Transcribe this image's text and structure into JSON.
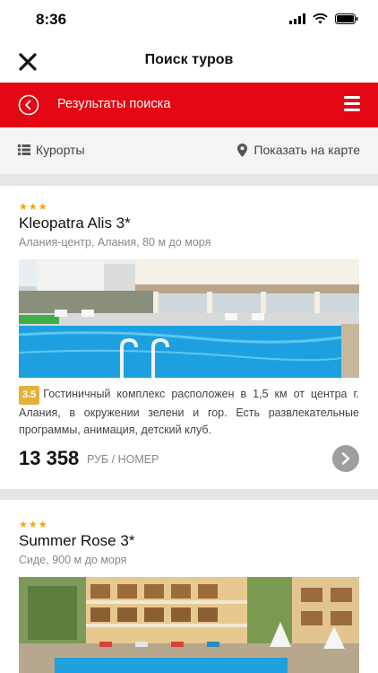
{
  "status_bar": {
    "time": "8:36"
  },
  "nav": {
    "title": "Поиск туров"
  },
  "results_bar": {
    "title": "Результаты поиска"
  },
  "filters": {
    "resorts_label": "Курорты",
    "map_label": "Показать на карте"
  },
  "hotels": [
    {
      "stars": "★★★",
      "name": "Kleopatra Alis 3*",
      "location": "Алания-центр, Алания, 80 м до моря",
      "rating": "3.5",
      "description": "Гостиничный комплекс расположен в 1,5 км от центра г. Алания, в окружении зелени и гор. Есть развлекательные программы, анимация, детский клуб.",
      "price": "13 358",
      "price_unit": "РУБ / НОМЕР"
    },
    {
      "stars": "★★★",
      "name": "Summer Rose 3*",
      "location": "Сиде, 900 м до моря"
    }
  ],
  "colors": {
    "accent": "#e30613",
    "rating": "#e3b23c",
    "pool": "#1ea0e0"
  }
}
